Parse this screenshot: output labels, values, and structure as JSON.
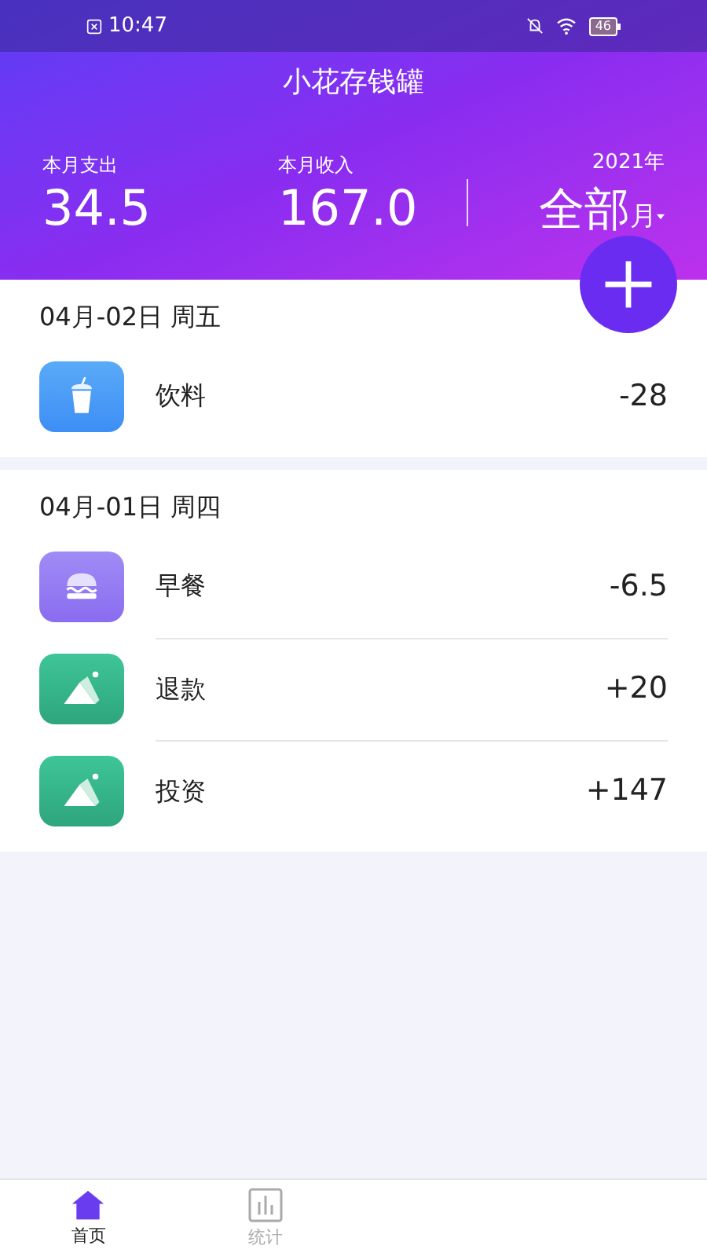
{
  "status_bar": {
    "time": "10:47",
    "battery": "46"
  },
  "header": {
    "title": "小花存钱罐",
    "expense_label": "本月支出",
    "expense": "34.5",
    "income_label": "本月收入",
    "income": "167.0",
    "year": "2021年",
    "period": "全部",
    "period_unit": "月"
  },
  "groups": [
    {
      "date": "04月-02日 周五",
      "items": [
        {
          "kind": "drink",
          "name": "饮料",
          "amount": "-28"
        }
      ]
    },
    {
      "date": "04月-01日 周四",
      "items": [
        {
          "kind": "food",
          "name": "早餐",
          "amount": "-6.5"
        },
        {
          "kind": "other",
          "name": "退款",
          "amount": "+20"
        },
        {
          "kind": "other",
          "name": "投资",
          "amount": "+147"
        }
      ]
    }
  ],
  "tabs": [
    {
      "kind": "home",
      "label": "首页",
      "selected": true
    },
    {
      "kind": "stats",
      "label": "统计",
      "selected": false
    }
  ]
}
